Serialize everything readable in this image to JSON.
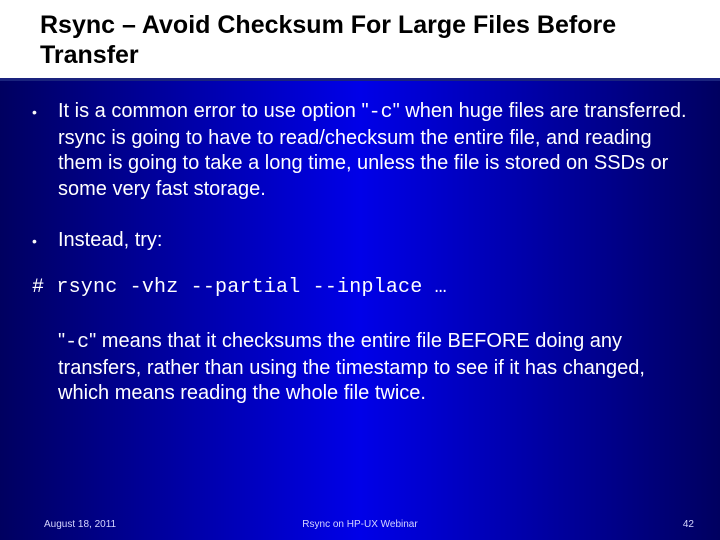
{
  "title": "Rsync – Avoid Checksum For Large Files Before Transfer",
  "bullets": {
    "b1_pre": "It is a common error to use option \"",
    "b1_flag": "-c",
    "b1_post": "\" when huge files are transferred. rsync is going to have to read/checksum the entire file, and reading them is going to take a long time, unless the file is stored on SSDs or some very fast storage.",
    "b2": "Instead, try:"
  },
  "command": "# rsync -vhz --partial --inplace …",
  "note_pre": "\"",
  "note_flag": "-c",
  "note_post": "\" means that it checksums the entire file BEFORE doing any transfers, rather than using the timestamp to see if it has changed, which means reading the whole file twice.",
  "footer": {
    "date": "August 18, 2011",
    "center": "Rsync on HP-UX Webinar",
    "page": "42"
  }
}
